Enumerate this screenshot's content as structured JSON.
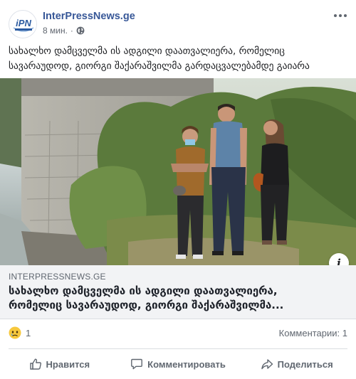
{
  "post": {
    "page_name": "InterPressNews.ge",
    "time": "8 мин.",
    "visibility_icon": "globe-icon",
    "caption": "სახალხო დამცველმა ის ადგილი დაათვალიერა, რომელიც\nსავარაუდოდ, გიორგი შაქარაშვილმა გარდაცვალებამდე გაიარა",
    "avatar_text": "iPN"
  },
  "link_card": {
    "domain": "INTERPRESSNEWS.GE",
    "title": "სახალხო დამცველმა ის ადგილი დაათვალიერა,\nრომელიც სავარაუდოდ, გიორგი შაქარაშვილმა..."
  },
  "stats": {
    "reaction_icon": "sad-face-icon",
    "reaction_count": "1",
    "comments": "Комментарии: 1"
  },
  "actions": {
    "like": "Нравится",
    "comment": "Комментировать",
    "share": "Поделиться"
  },
  "colors": {
    "link_blue": "#385898",
    "muted": "#606770",
    "card_bg": "#f2f3f5"
  }
}
